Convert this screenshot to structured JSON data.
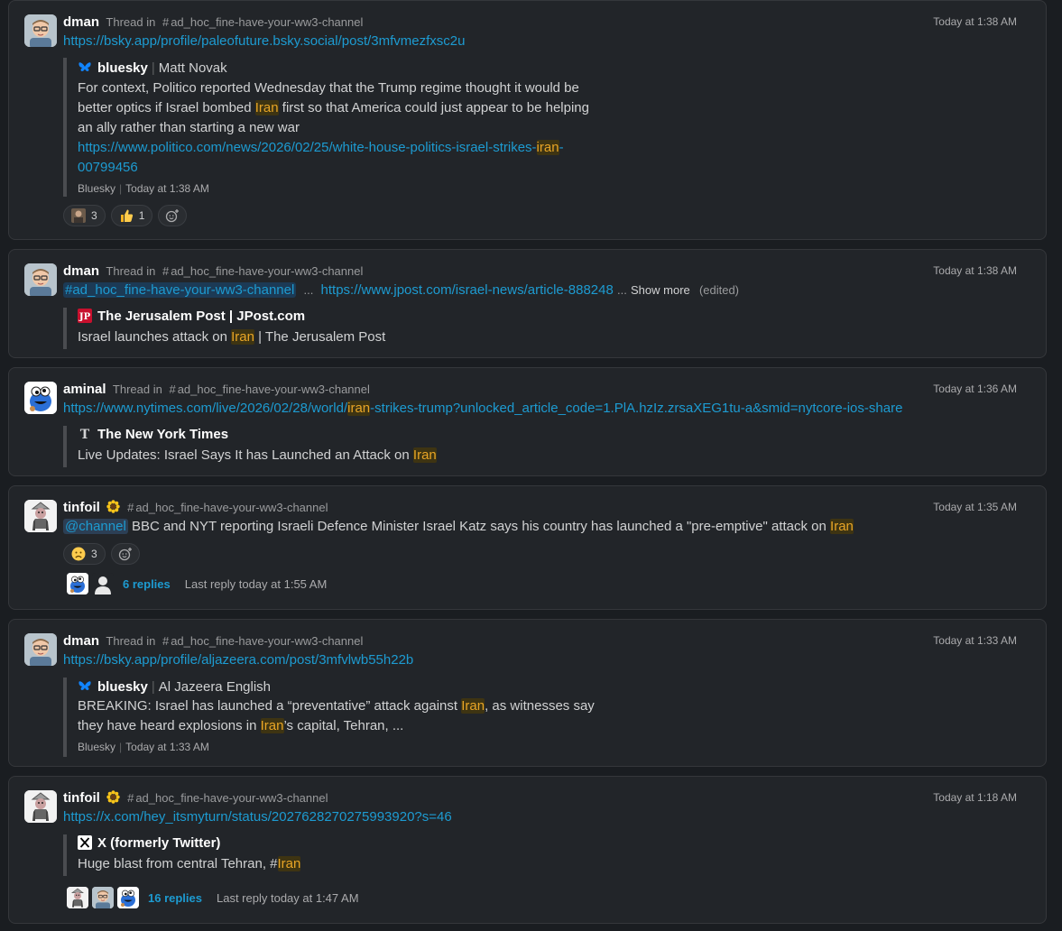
{
  "messages": [
    {
      "author": "dman",
      "thread_prefix": "Thread in",
      "channel": "ad_hoc_fine-have-your-ww3-channel",
      "time": "Today at 1:38 AM",
      "link": "https://bsky.app/profile/paleofuture.bsky.social/post/3mfvmezfxsc2u",
      "unfurl": {
        "source": "bluesky",
        "subtitle": "Matt Novak",
        "body_1": "For context, Politico reported Wednesday that the Trump regime thought it would be",
        "body_2a": "better optics if Israel bombed ",
        "body_2hl": "Iran",
        "body_2b": " first so that America could just appear to be helping",
        "body_3": "an ally rather than starting a new war",
        "url_a": "https://www.politico.com/news/2026/02/25/white-house-politics-israel-strikes-",
        "url_hl": "iran",
        "url_b": "-",
        "url_c": "00799456",
        "footer_source": "Bluesky",
        "footer_time": "Today at 1:38 AM"
      },
      "reactions": [
        {
          "emoji": "custom-avatar",
          "count": "3"
        },
        {
          "emoji": "thumbs-up",
          "count": "1"
        }
      ]
    },
    {
      "author": "dman",
      "thread_prefix": "Thread in",
      "channel": "ad_hoc_fine-have-your-ww3-channel",
      "time": "Today at 1:38 AM",
      "channel_link": "#ad_hoc_fine-have-your-ww3-channel",
      "dots": "...",
      "link": "https://www.jpost.com/israel-news/article-888248",
      "ellipsis": "...",
      "show_more": "Show more",
      "edited": "(edited)",
      "unfurl": {
        "source": "The Jerusalem Post | JPost.com",
        "body_a": "Israel launches attack on ",
        "body_hl": "Iran",
        "body_b": " | The Jerusalem Post"
      }
    },
    {
      "author": "aminal",
      "thread_prefix": "Thread in",
      "channel": "ad_hoc_fine-have-your-ww3-channel",
      "time": "Today at 1:36 AM",
      "link_a": "https://www.nytimes.com/live/2026/02/28/world/",
      "link_hl": "iran",
      "link_b": "-strikes-trump?unlocked_article_code=1.PlA.hzIz.zrsaXEG1tu-a&smid=nytcore-ios-share",
      "unfurl": {
        "source": "The New York Times",
        "body_a": "Live Updates: Israel Says It has Launched an Attack on ",
        "body_hl": "Iran"
      }
    },
    {
      "author": "tinfoil",
      "status_emoji": "sunflower",
      "channel": "ad_hoc_fine-have-your-ww3-channel",
      "time": "Today at 1:35 AM",
      "mention": "@channel",
      "text_a": " BBC and NYT reporting Israeli Defence Minister Israel Katz says his country has launched a \"pre-emptive\" attack on ",
      "text_hl": "Iran",
      "reactions": [
        {
          "emoji": "frowning-face",
          "count": "3"
        }
      ],
      "replies": "6 replies",
      "last_reply": "Last reply today at 1:55 AM"
    },
    {
      "author": "dman",
      "thread_prefix": "Thread in",
      "channel": "ad_hoc_fine-have-your-ww3-channel",
      "time": "Today at 1:33 AM",
      "link": "https://bsky.app/profile/aljazeera.com/post/3mfvlwb55h22b",
      "unfurl": {
        "source": "bluesky",
        "subtitle": "Al Jazeera English",
        "body_1a": "BREAKING: Israel has launched a “preventative” attack against ",
        "body_1hl": "Iran",
        "body_1b": ", as witnesses say",
        "body_2a": "they have heard explosions in ",
        "body_2hl": "Iran",
        "body_2b": "’s capital, Tehran, ...",
        "footer_source": "Bluesky",
        "footer_time": "Today at 1:33 AM"
      }
    },
    {
      "author": "tinfoil",
      "status_emoji": "sunflower",
      "channel": "ad_hoc_fine-have-your-ww3-channel",
      "time": "Today at 1:18 AM",
      "link": "https://x.com/hey_itsmyturn/status/2027628270275993920?s=46",
      "unfurl": {
        "source": "X (formerly Twitter)",
        "body_a": "Huge blast from central Tehran, #",
        "body_hl": "Iran"
      },
      "replies": "16 replies",
      "last_reply": "Last reply today at 1:47 AM"
    }
  ],
  "colors": {
    "background": "#1a1d21",
    "card": "#222529",
    "link": "#1d9bd1",
    "highlight_text": "#e8a526",
    "highlight_bg": "#3e3412"
  }
}
